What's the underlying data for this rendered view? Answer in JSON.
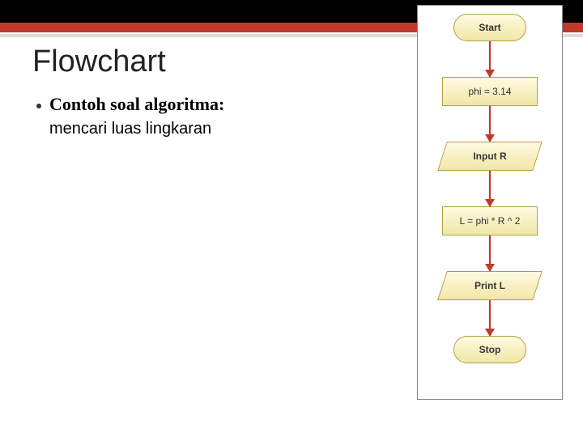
{
  "title": "Flowchart",
  "bullet": {
    "subhead": "Contoh soal algoritma:",
    "desc": "mencari luas lingkaran"
  },
  "flowchart": {
    "start": "Start",
    "step1": "phi = 3.14",
    "step2": "Input R",
    "step3": "L = phi * R ^ 2",
    "step4": "Print L",
    "stop": "Stop"
  }
}
